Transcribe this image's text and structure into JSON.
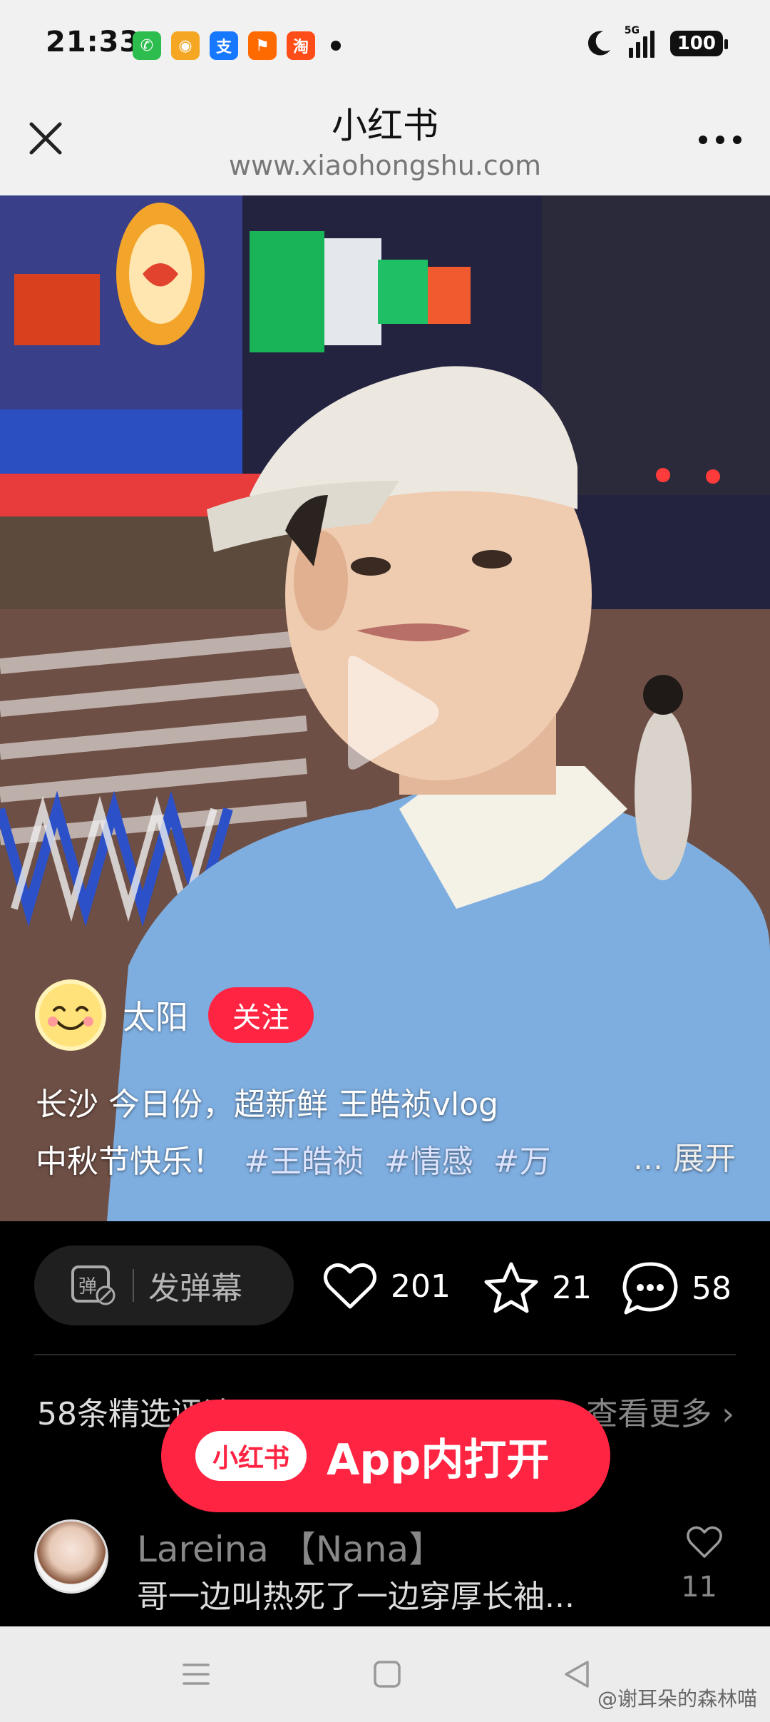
{
  "status_bar": {
    "time": "21:33",
    "apps": [
      {
        "icon": "wechat-icon",
        "glyph": "✆",
        "color": "#2dbd4e"
      },
      {
        "icon": "weibo-icon",
        "glyph": "◉",
        "color": "#f5a623"
      },
      {
        "icon": "alipay-icon",
        "glyph": "支",
        "color": "#1677ff"
      },
      {
        "icon": "1688-icon",
        "glyph": "⚑",
        "color": "#ff6a00"
      },
      {
        "icon": "taobao-icon",
        "glyph": "淘",
        "color": "#ff4d1a"
      }
    ],
    "network": "5G",
    "battery": "100"
  },
  "browser": {
    "title": "小红书",
    "url": "www.xiaohongshu.com"
  },
  "post": {
    "author": "太阳",
    "follow_label": "关注",
    "desc_line1": "长沙 今日份，超新鲜 王皓祯vlog",
    "desc_line2_text": "中秋节快乐！",
    "tags": [
      "#王皓祯",
      "#情感",
      "#万"
    ],
    "expand_label": "... 展开"
  },
  "actions": {
    "danmu_label": "发弹幕",
    "likes": "201",
    "stars": "21",
    "comments": "58"
  },
  "comments": {
    "header": "58条精选评论",
    "view_more": "查看更多 ›",
    "items": [
      {
        "user": "Lareina 【Nana】",
        "text": "哥一边叫热死了一边穿厚长袖...",
        "likes": "11"
      }
    ]
  },
  "open_app": {
    "logo": "小红书",
    "label": "App内打开"
  },
  "watermark": "@谢耳朵的森林喵",
  "colors": {
    "accent": "#ff2442",
    "background": "#000000",
    "chrome": "#f1f1f1"
  }
}
